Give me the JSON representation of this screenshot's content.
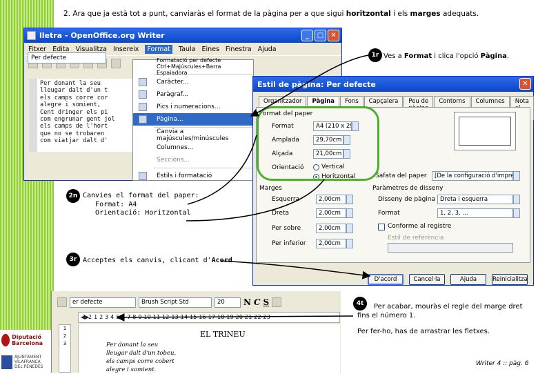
{
  "instruction": {
    "prefix": "2. Ara que ja està tot a punt, canviaràs el format de la pàgina per a que sigui ",
    "bold1": "horitzontal",
    "middle": " i els ",
    "bold2": "marges",
    "suffix": " adequats."
  },
  "writer_window": {
    "title": "lletra - OpenOffice.org Writer",
    "menu": [
      "Fitxer",
      "Edita",
      "Visualitza",
      "Insereix",
      "Format",
      "Taula",
      "Eines",
      "Finestra",
      "Ajuda"
    ],
    "active_menu": "Format",
    "paragraph_style": "Per defecte",
    "document_lines": [
      "Per donant la seu",
      "lleugar dalt d'un t",
      "els camps corre cor",
      "alegre i somient,",
      "Cent dringer els pi",
      "com engrunar gent jol",
      "els camps de l'hort",
      "que no se trobaren",
      "com viatjar dalt d'"
    ],
    "ruler_marks": [
      "1",
      "2",
      "3"
    ]
  },
  "format_menu": {
    "items": [
      {
        "label": "Formatació per defecte Ctrl+Majúscules+Barra Espaiadora",
        "icon": "",
        "state": "normal"
      },
      {
        "label": "Caràcter...",
        "icon": "character-icon",
        "state": "normal"
      },
      {
        "label": "Paràgraf...",
        "icon": "paragraph-icon",
        "state": "normal"
      },
      {
        "label": "Pics i numeracions...",
        "icon": "bullets-icon",
        "state": "normal"
      },
      {
        "label": "Pàgina...",
        "icon": "page-icon",
        "state": "highlighted"
      },
      {
        "label": "Canvia a majúscules/minúscules",
        "icon": "",
        "state": "normal"
      },
      {
        "label": "Columnes...",
        "icon": "",
        "state": "normal"
      },
      {
        "label": "Seccions...",
        "icon": "",
        "state": "disabled"
      },
      {
        "label": "Estils i formatació",
        "icon": "styles-icon",
        "state": "normal"
      }
    ]
  },
  "page_dialog": {
    "title": "Estil de pàgina: Per defecte",
    "tabs": [
      "Organitzador",
      "Pàgina",
      "Fons",
      "Capçalera",
      "Peu de pàgina",
      "Contorns",
      "Columnes",
      "Nota al peu"
    ],
    "active_tab": "Pàgina",
    "paper_format": {
      "group": "Format del paper",
      "format_label": "Format",
      "format_value": "A4 (210 x 297 m",
      "width_label": "Amplada",
      "width_value": "29,70cm",
      "height_label": "Alçada",
      "height_value": "21,00cm",
      "orientation_label": "Orientació",
      "portrait": "Vertical",
      "landscape": "Horitzontal",
      "selected": "Horitzontal",
      "tray_label": "Safata del paper",
      "tray_value": "[De la configuració d'impress"
    },
    "margins": {
      "group": "Marges",
      "left_label": "Esquerra",
      "left_value": "2,00cm",
      "right_label": "Dreta",
      "right_value": "2,00cm",
      "top_label": "Per sobre",
      "top_value": "2,00cm",
      "bottom_label": "Per inferior",
      "bottom_value": "2,00cm"
    },
    "layout": {
      "group": "Paràmetres de disseny",
      "page_layout_label": "Disseny de pàgina",
      "page_layout_value": "Dreta i esquerra",
      "format_label": "Format",
      "format_value": "1, 2, 3, ...",
      "register_label": "Conforme al registre",
      "reference_label": "Estil de referència"
    },
    "buttons": {
      "ok": "D'acord",
      "cancel": "Cancel·la",
      "help": "Ajuda",
      "reset": "Reinicialitza"
    }
  },
  "steps": {
    "s1_num": "1r",
    "s1_pre": "Ves a ",
    "s1_bold1": "Format",
    "s1_mid": " i clica l'opció ",
    "s1_bold2": "Pàgina",
    "s1_suf": ".",
    "s2_num": "2n",
    "s2_text": "Canvies el format del paper:\n   Format: A4\n   Orientació: Horitzontal",
    "s3_num": "3r",
    "s3_pre": "Acceptes els canvis, clicant d'",
    "s3_bold": "Acord",
    "s3_suf": ".",
    "s4_num": "4t",
    "s4_text": "Per acabar, mouràs el regle del marge dret fins el número 1.",
    "s4_text2": "Per fer-ho, has de arrastrar les fletxes."
  },
  "writer_window2": {
    "style": "er defecte",
    "font": "Brush Script Std",
    "size": "20",
    "format_buttons": [
      "N",
      "C",
      "S"
    ],
    "ruler": "1  2  1  2  3  4  5  6  7  8  9  10  11  12  13  14  15  16  17  18  19  20  21  22  23",
    "vertical_ruler": [
      "1",
      "2",
      "3"
    ],
    "page_title": "EL TRINEU",
    "page_lines": [
      "Per donant la seu",
      "lleugar dalt d'un tobeu,",
      "els camps corre cobert",
      "alegre i somient."
    ]
  },
  "footer": "Writer 4 :: pàg. 6",
  "logos": {
    "diputacio": "Diputació Barcelona",
    "ajuntament": "AJUNTAMENT VILAFRANCA DEL PENEDÈS"
  },
  "colors": {
    "stripe": "#8fcf3a",
    "highlight_circle": "#4caf2a",
    "xp_title": "#0b46c9",
    "menu_highlight": "#316ac5"
  }
}
